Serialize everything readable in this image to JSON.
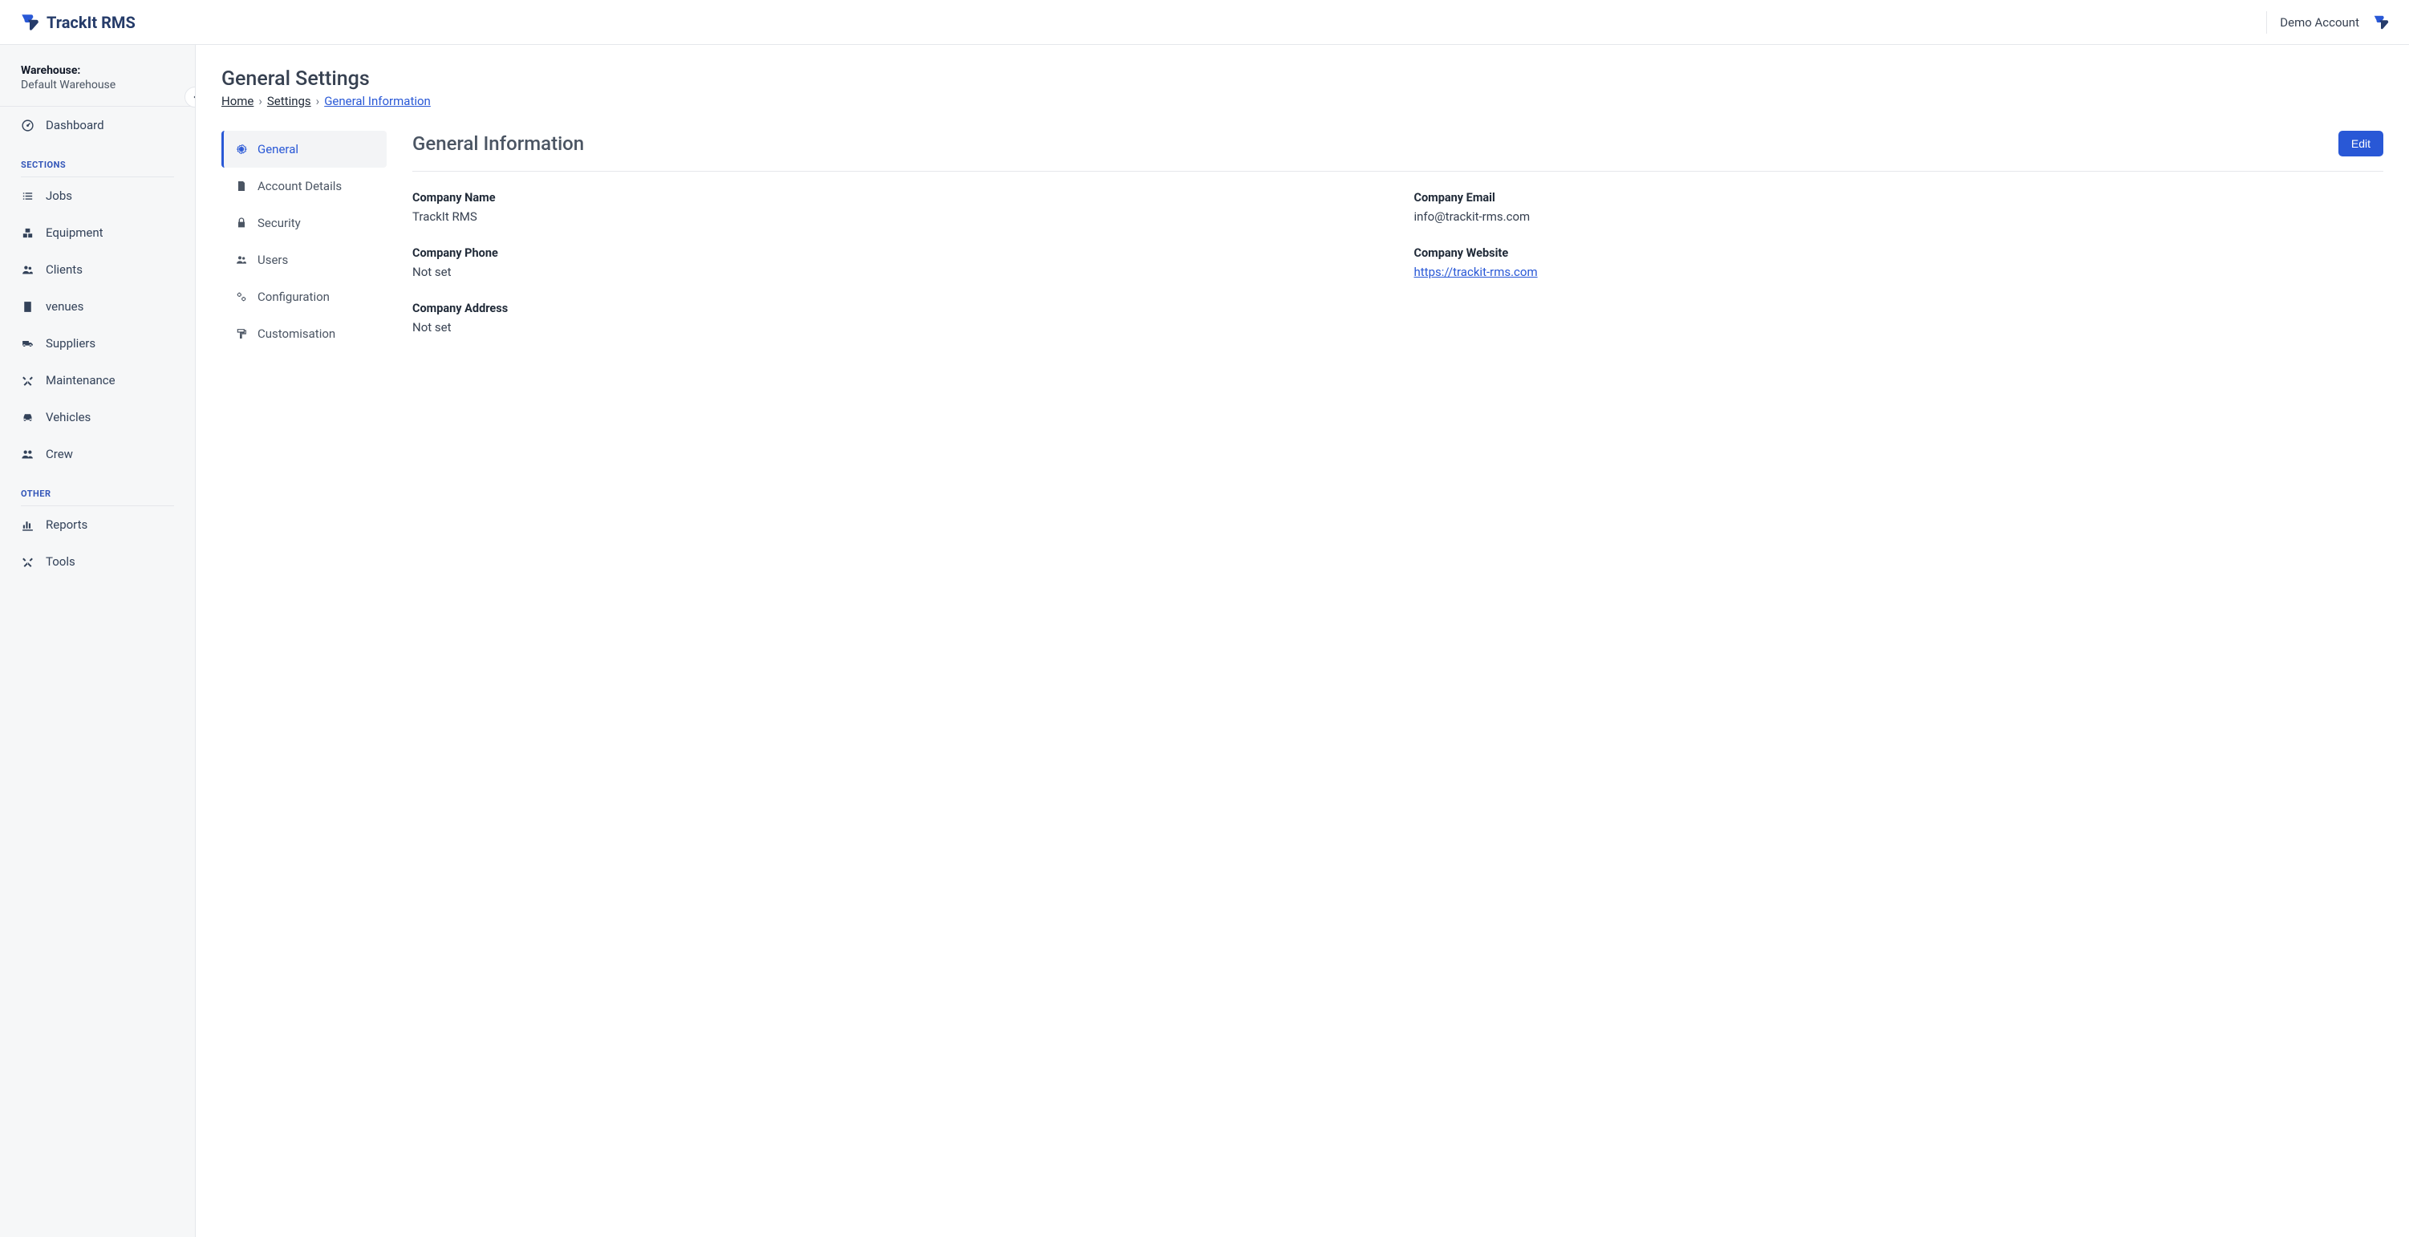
{
  "brand": {
    "name": "TrackIt RMS"
  },
  "header": {
    "account_name": "Demo Account"
  },
  "sidebar": {
    "warehouse_label": "Warehouse:",
    "warehouse_name": "Default Warehouse",
    "dashboard": "Dashboard",
    "sections_heading": "SECTIONS",
    "other_heading": "OTHER",
    "items": [
      {
        "label": "Jobs"
      },
      {
        "label": "Equipment"
      },
      {
        "label": "Clients"
      },
      {
        "label": "venues"
      },
      {
        "label": "Suppliers"
      },
      {
        "label": "Maintenance"
      },
      {
        "label": "Vehicles"
      },
      {
        "label": "Crew"
      }
    ],
    "other_items": [
      {
        "label": "Reports"
      },
      {
        "label": "Tools"
      }
    ]
  },
  "page": {
    "title": "General Settings",
    "breadcrumb": {
      "home": "Home",
      "settings": "Settings",
      "current": "General Information"
    }
  },
  "subnav": {
    "items": [
      {
        "label": "General"
      },
      {
        "label": "Account Details"
      },
      {
        "label": "Security"
      },
      {
        "label": "Users"
      },
      {
        "label": "Configuration"
      },
      {
        "label": "Customisation"
      }
    ]
  },
  "panel": {
    "title": "General Information",
    "edit_label": "Edit",
    "fields": {
      "company_name": {
        "label": "Company Name",
        "value": "TrackIt RMS"
      },
      "company_email": {
        "label": "Company Email",
        "value": "info@trackit-rms.com"
      },
      "company_phone": {
        "label": "Company Phone",
        "value": "Not set"
      },
      "company_website": {
        "label": "Company Website",
        "value": "https://trackit-rms.com"
      },
      "company_address": {
        "label": "Company Address",
        "value": "Not set"
      }
    }
  }
}
